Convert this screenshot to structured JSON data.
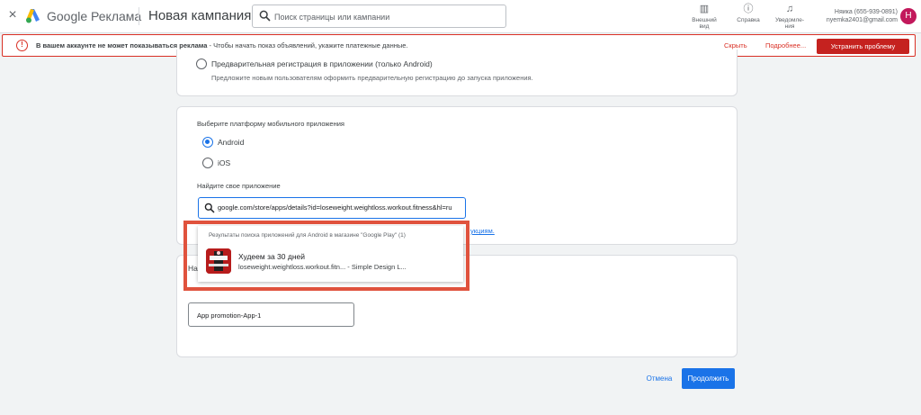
{
  "header": {
    "close_glyph": "×",
    "brand": "Google Реклама",
    "page_title": "Новая кампания",
    "search_placeholder": "Поиск страницы или кампании",
    "appearance_label": "Внешний вид",
    "help_label": "Справка",
    "notifications_label": "Уведомле-ния",
    "account_name": "Няика (655-939-0891)",
    "account_email": "nyemka2401@gmail.com",
    "avatar_letter": "Н"
  },
  "alert": {
    "icon": "!",
    "message_bold": "В вашем аккаунте не может показываться реклама",
    "message_rest": " - Чтобы начать показ объявлений, укажите платежные данные.",
    "hide": "Скрыть",
    "more": "Подробнее...",
    "fix": "Устранить проблему"
  },
  "campaign_goal": {
    "option_label": "Предварительная регистрация в приложении (только Android)",
    "option_desc": "Предложите новым пользователям оформить предварительную регистрацию до запуска приложения."
  },
  "platform": {
    "heading": "Выберите платформу мобильного приложения",
    "options": [
      {
        "label": "Android",
        "selected": true
      },
      {
        "label": "iOS",
        "selected": false
      }
    ],
    "find_label": "Найдите свое приложение",
    "search_value": "google.com/store/apps/details?id=loseweight.weightloss.workout.fitness&hl=ru",
    "link_tail": "укциям."
  },
  "results": {
    "header": "Результаты поиска приложений для Android в магазине \"Google Play\" (1)",
    "items": [
      {
        "title": "Худеем за 30 дней",
        "subtitle": "loseweight.weightloss.workout.fitn... - Simple Design L..."
      }
    ]
  },
  "name_section": {
    "heading_partial": "На",
    "input_value": "App promotion-App-1"
  },
  "footer": {
    "cancel": "Отмена",
    "continue": "Продолжить"
  },
  "colors": {
    "accent": "#1a73e8",
    "alert_red": "#c5221f",
    "highlight_frame": "#e0523d",
    "avatar": "#c2185b"
  }
}
